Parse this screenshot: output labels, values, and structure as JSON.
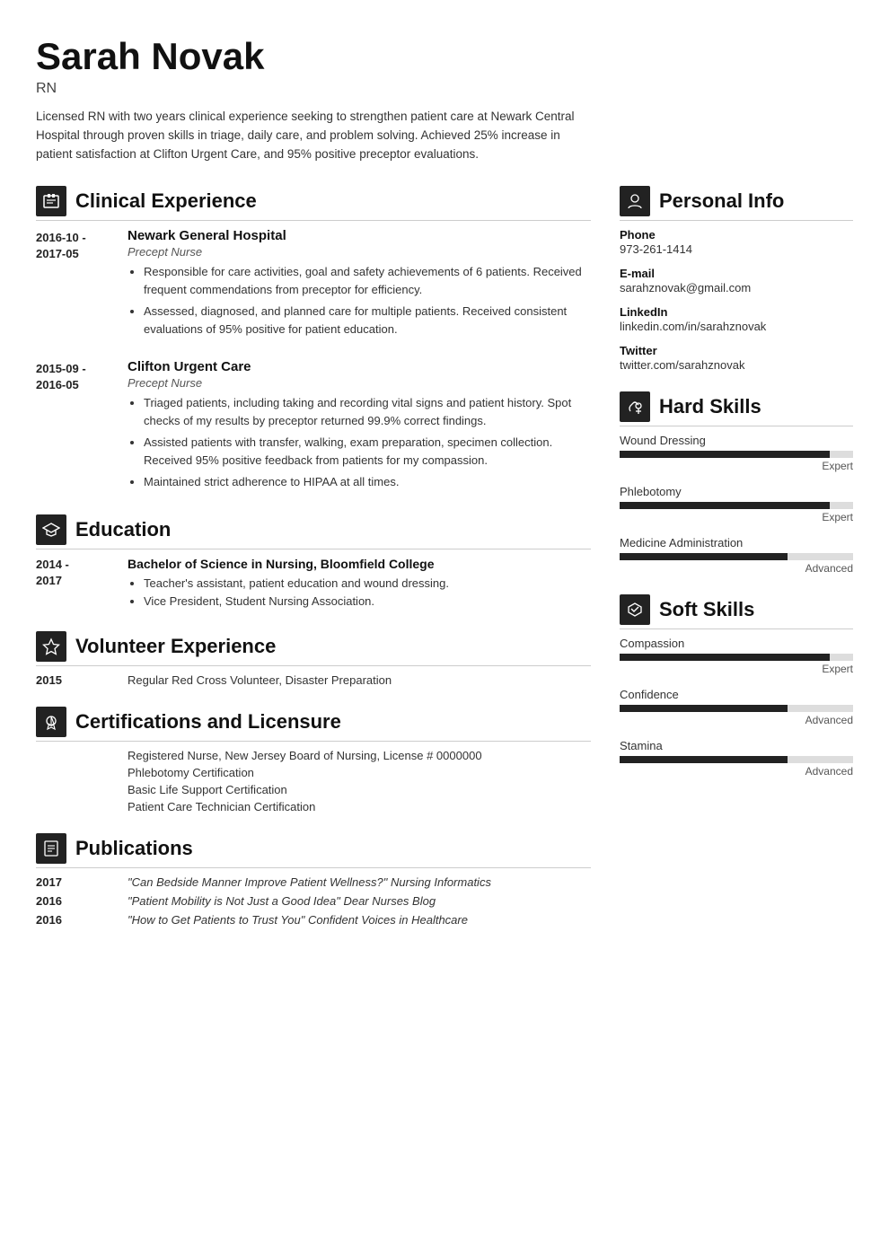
{
  "header": {
    "name": "Sarah Novak",
    "title": "RN",
    "summary": "Licensed RN with two years clinical experience seeking to strengthen patient care at Newark Central Hospital through proven skills in triage, daily care, and problem solving. Achieved 25% increase in patient satisfaction at Clifton Urgent Care, and 95% positive preceptor evaluations."
  },
  "sections": {
    "clinical_experience": {
      "title": "Clinical Experience",
      "entries": [
        {
          "date": "2016-10 -\n2017-05",
          "org": "Newark General Hospital",
          "role": "Precept Nurse",
          "bullets": [
            "Responsible for care activities, goal and safety achievements of 6 patients. Received frequent commendations from preceptor for efficiency.",
            "Assessed, diagnosed, and planned care for multiple patients. Received consistent evaluations of 95% positive for patient education."
          ]
        },
        {
          "date": "2015-09 -\n2016-05",
          "org": "Clifton Urgent Care",
          "role": "Precept Nurse",
          "bullets": [
            "Triaged patients, including taking and recording vital signs and patient history. Spot checks of my results by preceptor returned 99.9% correct findings.",
            "Assisted patients with transfer, walking, exam preparation, specimen collection. Received 95% positive feedback from patients for my compassion.",
            "Maintained strict adherence to HIPAA at all times."
          ]
        }
      ]
    },
    "education": {
      "title": "Education",
      "entries": [
        {
          "date": "2014 -\n2017",
          "org": "Bachelor of Science in Nursing, Bloomfield College",
          "bullets": [
            "Teacher's assistant, patient education and wound dressing.",
            "Vice President, Student Nursing Association."
          ]
        }
      ]
    },
    "volunteer": {
      "title": "Volunteer Experience",
      "entries": [
        {
          "year": "2015",
          "desc": "Regular Red Cross Volunteer, Disaster Preparation"
        }
      ]
    },
    "certifications": {
      "title": "Certifications and Licensure",
      "entries": [
        "Registered Nurse, New Jersey Board of Nursing, License # 0000000",
        "Phlebotomy Certification",
        "Basic Life Support Certification",
        "Patient Care Technician Certification"
      ]
    },
    "publications": {
      "title": "Publications",
      "entries": [
        {
          "year": "2017",
          "desc": "\"Can Bedside Manner Improve Patient Wellness?\" Nursing Informatics"
        },
        {
          "year": "2016",
          "desc": "\"Patient Mobility is Not Just a Good Idea\" Dear Nurses Blog"
        },
        {
          "year": "2016",
          "desc": "\"How to Get Patients to Trust You\" Confident Voices in Healthcare"
        }
      ]
    }
  },
  "right": {
    "personal_info": {
      "title": "Personal Info",
      "items": [
        {
          "label": "Phone",
          "value": "973-261-1414"
        },
        {
          "label": "E-mail",
          "value": "sarahznovak@gmail.com"
        },
        {
          "label": "LinkedIn",
          "value": "linkedin.com/in/sarahznovak"
        },
        {
          "label": "Twitter",
          "value": "twitter.com/sarahznovak"
        }
      ]
    },
    "hard_skills": {
      "title": "Hard Skills",
      "items": [
        {
          "name": "Wound Dressing",
          "level": "Expert",
          "pct": 90
        },
        {
          "name": "Phlebotomy",
          "level": "Expert",
          "pct": 90
        },
        {
          "name": "Medicine Administration",
          "level": "Advanced",
          "pct": 72
        }
      ]
    },
    "soft_skills": {
      "title": "Soft Skills",
      "items": [
        {
          "name": "Compassion",
          "level": "Expert",
          "pct": 90
        },
        {
          "name": "Confidence",
          "level": "Advanced",
          "pct": 72
        },
        {
          "name": "Stamina",
          "level": "Advanced",
          "pct": 72
        }
      ]
    }
  }
}
